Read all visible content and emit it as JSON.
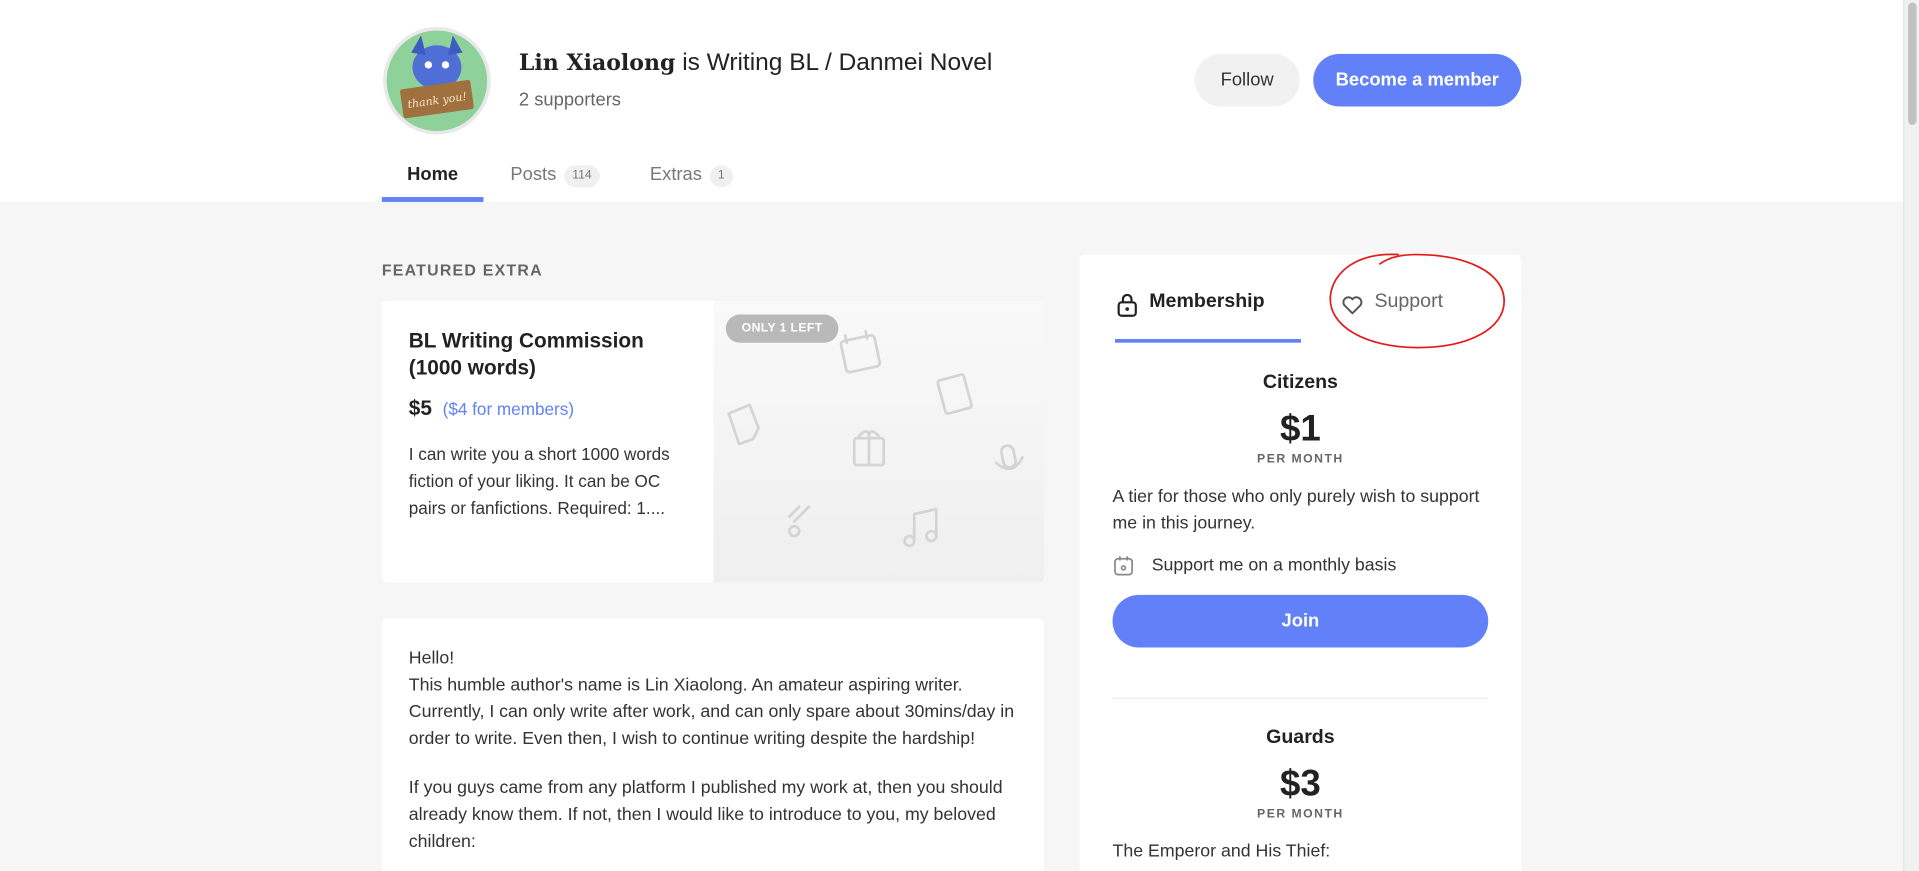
{
  "creator": {
    "name": "Lin Xiaolong",
    "title_suffix": " is Writing BL / Danmei Novel",
    "supporters": "2 supporters",
    "avatar_text": "thank you!"
  },
  "header_actions": {
    "follow_label": "Follow",
    "member_label": "Become a member"
  },
  "tabs": [
    {
      "label": "Home",
      "count": ""
    },
    {
      "label": "Posts",
      "count": "114"
    },
    {
      "label": "Extras",
      "count": "1"
    }
  ],
  "featured": {
    "section_label": "FEATURED EXTRA",
    "title": "BL Writing Commission (1000 words)",
    "price": "$5",
    "member_price": "($4 for members)",
    "description": "I can write you a short 1000 words fiction of your liking. It can be OC pairs or fanfictions. Required: 1....",
    "badge": "ONLY 1 LEFT"
  },
  "about": {
    "paragraphs": [
      "Hello!\nThis humble author's name is Lin Xiaolong. An amateur aspiring writer. Currently, I can only write after work, and can only spare about 30mins/day in order to write. Even then, I wish to continue writing despite the hardship!",
      "If you guys came from any platform I published my work at, then you should already know them. If not, then I would like to introduce to you, my beloved children:"
    ]
  },
  "membership_panel": {
    "tab_membership": "Membership",
    "tab_support": "Support",
    "tiers": [
      {
        "name": "Citizens",
        "price": "$1",
        "period": "PER MONTH",
        "description": "A tier for those who only purely wish to support me in this journey.",
        "perk": "Support me on a monthly basis",
        "join_label": "Join"
      },
      {
        "name": "Guards",
        "price": "$3",
        "period": "PER MONTH",
        "description": "The Emperor and His Thief:"
      }
    ]
  },
  "colors": {
    "accent": "#6281f9",
    "annotation": "#e41b1b"
  }
}
